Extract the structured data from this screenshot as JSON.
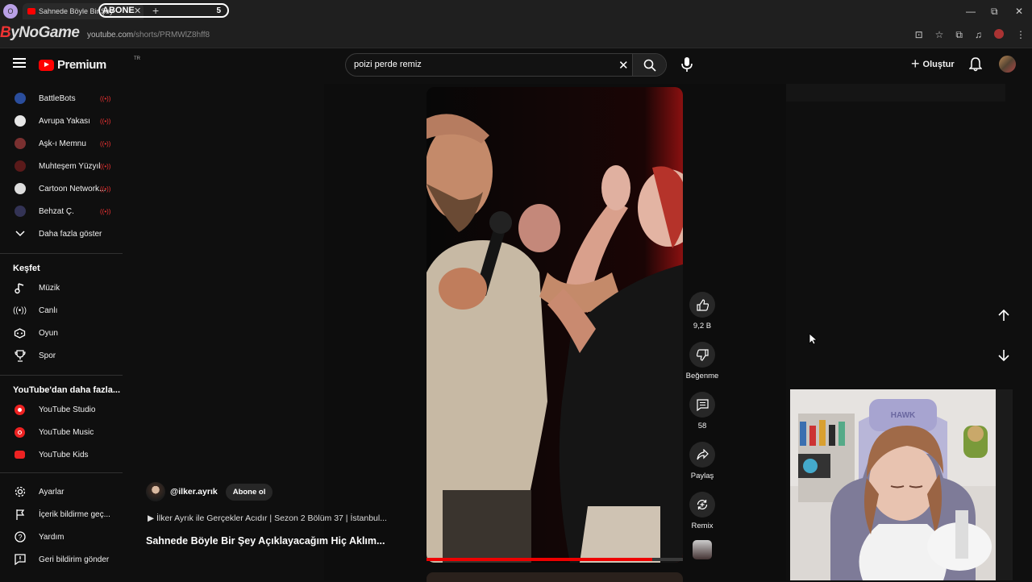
{
  "browser": {
    "profile_initial": "O",
    "tab_title": "Sahnede Böyle Bir Şey",
    "overlay_label": "ABONE",
    "overlay_count": "5",
    "url_host": "youtube.com",
    "url_path": "/shorts/PRMWlZ8hff8",
    "overlay_logo_a": "B",
    "overlay_logo_rest": "yNoGame"
  },
  "header": {
    "logo_text": "Premium",
    "logo_region": "TR",
    "search_value": "poizi perde remiz",
    "create_label": "Oluştur"
  },
  "sidebar": {
    "subscriptions": [
      {
        "label": "BattleBots",
        "color": "#2a4d9c"
      },
      {
        "label": "Avrupa Yakası",
        "color": "#e7e7e7"
      },
      {
        "label": "Aşk-ı Memnu",
        "color": "#7a3030"
      },
      {
        "label": "Muhteşem Yüzyıl",
        "color": "#5a1a1a"
      },
      {
        "label": "Cartoon Network...",
        "color": "#dddddd"
      },
      {
        "label": "Behzat Ç.",
        "color": "#333355"
      }
    ],
    "show_more": "Daha fazla göster",
    "explore_heading": "Keşfet",
    "explore": [
      {
        "label": "Müzik",
        "icon": "music-note-icon"
      },
      {
        "label": "Canlı",
        "icon": "live-icon"
      },
      {
        "label": "Oyun",
        "icon": "gamepad-icon"
      },
      {
        "label": "Spor",
        "icon": "trophy-icon"
      }
    ],
    "more_heading": "YouTube'dan daha fazla...",
    "more": [
      {
        "label": "YouTube Studio"
      },
      {
        "label": "YouTube Music"
      },
      {
        "label": "YouTube Kids"
      }
    ],
    "footer": [
      {
        "label": "Ayarlar",
        "icon": "gear-icon"
      },
      {
        "label": "İçerik bildirme geç...",
        "icon": "flag-icon"
      },
      {
        "label": "Yardım",
        "icon": "help-icon"
      },
      {
        "label": "Geri bildirim gönder",
        "icon": "feedback-icon"
      }
    ]
  },
  "short": {
    "channel": "@ilker.ayrık",
    "subscribe_label": "Abone ol",
    "playlist": "İlker Ayrık ile Gerçekler Acıdır | Sezon 2 Bölüm 37 | İstanbul...",
    "title": "Sahnede Böyle Bir Şey Açıklayacağım Hiç Aklım...",
    "progress": 0.88,
    "likes": "9,2 B",
    "dislike_label": "Beğenme",
    "comments": "58",
    "share_label": "Paylaş",
    "remix_label": "Remix"
  },
  "colors": {
    "accent": "#ff0000",
    "background": "#0f0f0f"
  }
}
